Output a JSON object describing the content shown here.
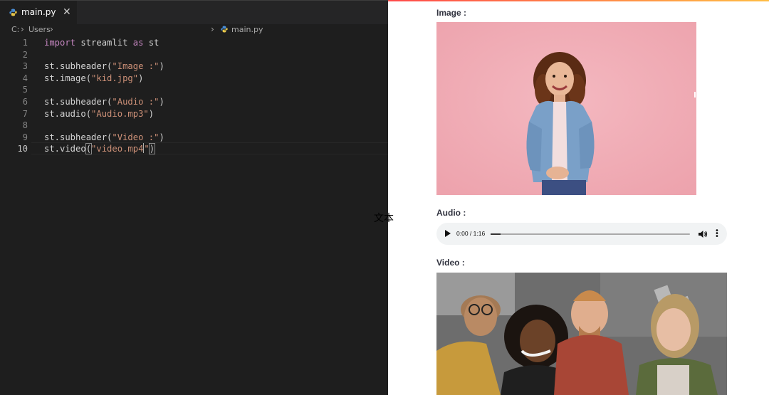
{
  "editor": {
    "tab": {
      "label": "main.py",
      "close": "✕"
    },
    "breadcrumb": {
      "drive": "C:",
      "folder": "Users",
      "file": "main.py"
    },
    "line_numbers": [
      "1",
      "2",
      "3",
      "4",
      "5",
      "6",
      "7",
      "8",
      "9",
      "10"
    ],
    "lines": [
      [
        {
          "t": "kw",
          "v": "import"
        },
        {
          "t": "id",
          "v": " streamlit "
        },
        {
          "t": "kw",
          "v": "as"
        },
        {
          "t": "id",
          "v": " st"
        }
      ],
      [],
      [
        {
          "t": "id",
          "v": "st.subheader("
        },
        {
          "t": "str",
          "v": "\"Image :\""
        },
        {
          "t": "id",
          "v": ")"
        }
      ],
      [
        {
          "t": "id",
          "v": "st.image("
        },
        {
          "t": "str",
          "v": "\"kid.jpg\""
        },
        {
          "t": "id",
          "v": ")"
        }
      ],
      [],
      [
        {
          "t": "id",
          "v": "st.subheader("
        },
        {
          "t": "str",
          "v": "\"Audio :\""
        },
        {
          "t": "id",
          "v": ")"
        }
      ],
      [
        {
          "t": "id",
          "v": "st.audio("
        },
        {
          "t": "str",
          "v": "\"Audio.mp3\""
        },
        {
          "t": "id",
          "v": ")"
        }
      ],
      [],
      [
        {
          "t": "id",
          "v": "st.subheader("
        },
        {
          "t": "str",
          "v": "\"Video :\""
        },
        {
          "t": "id",
          "v": ")"
        }
      ],
      [
        {
          "t": "id",
          "v": "st.video"
        },
        {
          "t": "bracket",
          "v": "("
        },
        {
          "t": "str",
          "v": "\"video.mp4"
        },
        {
          "t": "cursor",
          "v": ""
        },
        {
          "t": "str",
          "v": "\""
        },
        {
          "t": "bracket",
          "v": ")"
        }
      ]
    ],
    "active_line": 10
  },
  "overlay_text": "文本",
  "app": {
    "image_subheader": "Image :",
    "audio_subheader": "Audio :",
    "video_subheader": "Video :",
    "audio_player": {
      "time": "0:00 / 1:16",
      "progress": 0.05
    }
  },
  "colors": {
    "editor_bg": "#1e1e1e",
    "keyword": "#c586c0",
    "string": "#ce9178",
    "accent_gradient": [
      "#ff4b4b",
      "#ffbd45"
    ],
    "image_bg": "#f0aab4"
  }
}
